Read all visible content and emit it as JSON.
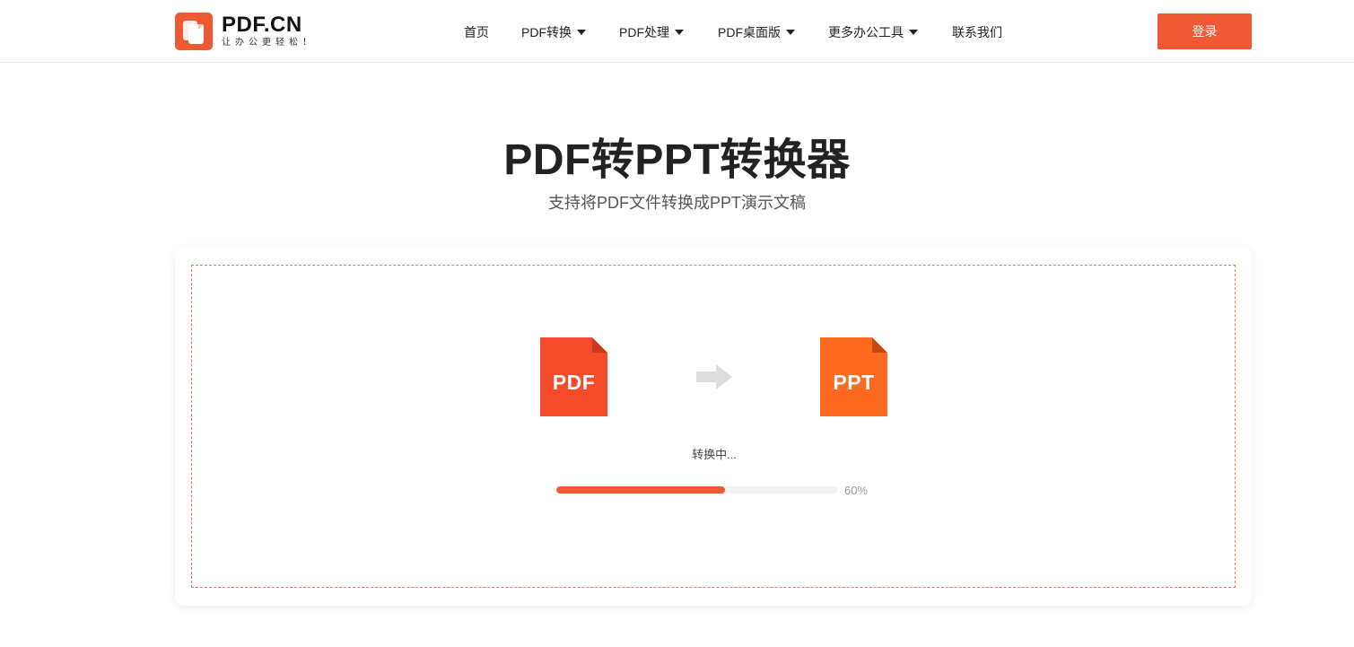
{
  "brand": {
    "name": "PDF.CN",
    "slogan": "让办公更轻松！",
    "color": "#ef5a35"
  },
  "nav": {
    "items": [
      {
        "label": "首页",
        "has_dropdown": false
      },
      {
        "label": "PDF转换",
        "has_dropdown": true
      },
      {
        "label": "PDF处理",
        "has_dropdown": true
      },
      {
        "label": "PDF桌面版",
        "has_dropdown": true
      },
      {
        "label": "更多办公工具",
        "has_dropdown": true
      },
      {
        "label": "联系我们",
        "has_dropdown": false
      }
    ],
    "login_label": "登录"
  },
  "hero": {
    "title": "PDF转PPT转换器",
    "subtitle": "支持将PDF文件转换成PPT演示文稿"
  },
  "conversion": {
    "source_label": "PDF",
    "source_color": "#f44b2b",
    "source_fold_color": "#c73a1c",
    "target_label": "PPT",
    "target_color": "#ff6a23",
    "target_fold_color": "#c54a10",
    "arrow_icon": "arrow-right-icon",
    "status_text": "转换中...",
    "progress_value": 60,
    "progress_text": "60%",
    "progress_color": "#ef5a35"
  }
}
